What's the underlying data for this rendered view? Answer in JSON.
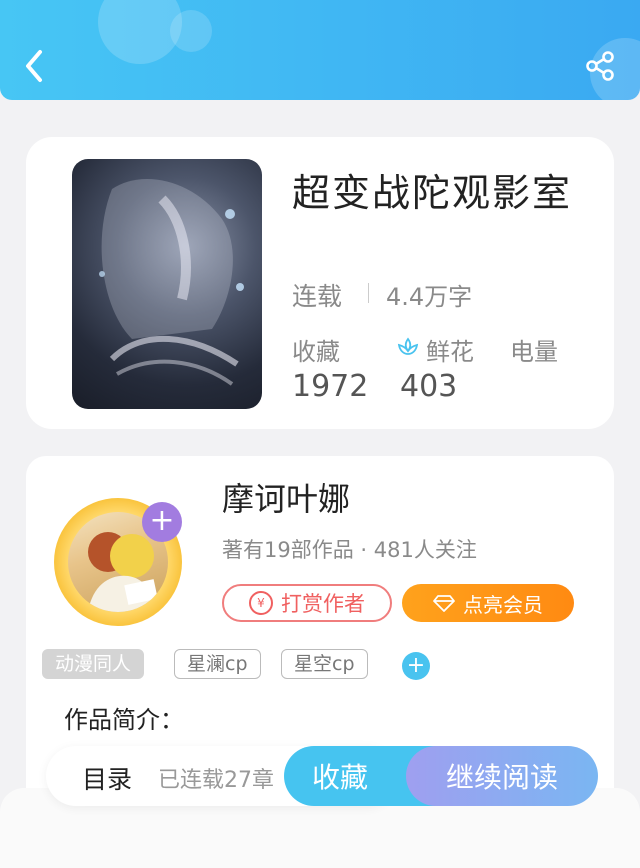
{
  "book": {
    "title": "超变战陀观影室",
    "status": "连载",
    "word_count": "4.4万字",
    "stats": [
      {
        "label": "收藏",
        "value": "1972"
      },
      {
        "label": "鲜花",
        "value": "403"
      },
      {
        "label": "电量",
        "value": ""
      }
    ]
  },
  "author": {
    "name": "摩诃叶娜",
    "info": "著有19部作品 · 481人关注",
    "tip_label": "打赏作者",
    "vip_label": "点亮会员",
    "follow_glyph": "+"
  },
  "tags": [
    "动漫同人",
    "星澜cp",
    "星空cp"
  ],
  "tag_add_glyph": "+",
  "intro_label": "作品简介：",
  "bottom_bar": {
    "toc_label": "目录",
    "toc_progress": "已连载27章",
    "collect_label": "收藏",
    "read_label": "继续阅读"
  },
  "colors": {
    "header_start": "#47c6f4",
    "header_end": "#3aa9f2",
    "tip_red": "#f06060",
    "vip_orange": "#ff9a18",
    "accent_blue": "#46c4f0",
    "read_purple": "#9f9ff0"
  },
  "icons": [
    "back-icon",
    "share-icon",
    "flower-icon",
    "yen-icon",
    "diamond-icon",
    "plus-icon"
  ]
}
